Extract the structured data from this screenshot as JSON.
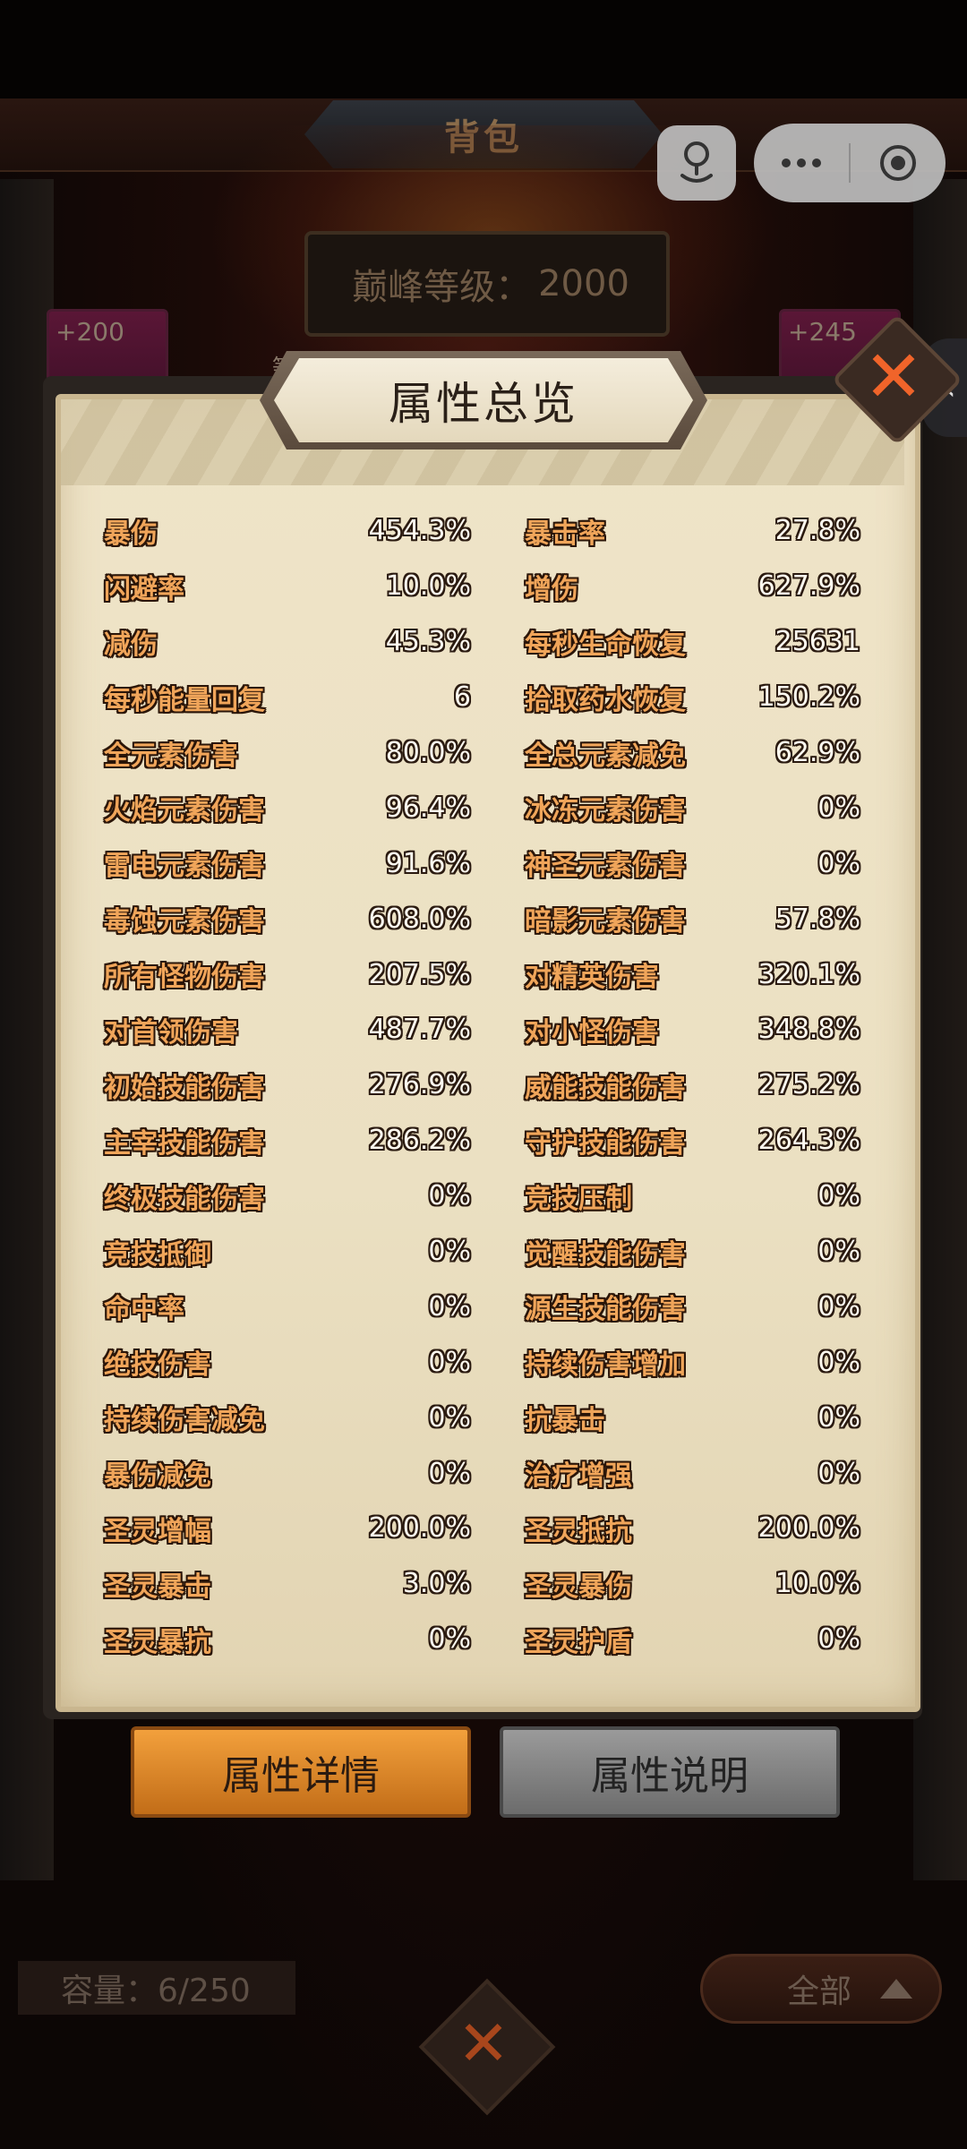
{
  "header": {
    "title": "背包"
  },
  "peak_level": {
    "label": "巅峰等级：",
    "value": "2000"
  },
  "bag_items": {
    "left_bonus": "+200",
    "right_bonus": "+245",
    "level_tag": "等级"
  },
  "dialog": {
    "title": "属性总览",
    "stats": [
      [
        {
          "name": "暴伤",
          "value": "454.3%"
        },
        {
          "name": "暴击率",
          "value": "27.8%"
        }
      ],
      [
        {
          "name": "闪避率",
          "value": "10.0%"
        },
        {
          "name": "增伤",
          "value": "627.9%"
        }
      ],
      [
        {
          "name": "减伤",
          "value": "45.3%"
        },
        {
          "name": "每秒生命恢复",
          "value": "25631"
        }
      ],
      [
        {
          "name": "每秒能量回复",
          "value": "6"
        },
        {
          "name": "拾取药水恢复",
          "value": "150.2%"
        }
      ],
      [
        {
          "name": "全元素伤害",
          "value": "80.0%"
        },
        {
          "name": "全总元素减免",
          "value": "62.9%"
        }
      ],
      [
        {
          "name": "火焰元素伤害",
          "value": "96.4%"
        },
        {
          "name": "冰冻元素伤害",
          "value": "0%"
        }
      ],
      [
        {
          "name": "雷电元素伤害",
          "value": "91.6%"
        },
        {
          "name": "神圣元素伤害",
          "value": "0%"
        }
      ],
      [
        {
          "name": "毒蚀元素伤害",
          "value": "608.0%"
        },
        {
          "name": "暗影元素伤害",
          "value": "57.8%"
        }
      ],
      [
        {
          "name": "所有怪物伤害",
          "value": "207.5%"
        },
        {
          "name": "对精英伤害",
          "value": "320.1%"
        }
      ],
      [
        {
          "name": "对首领伤害",
          "value": "487.7%"
        },
        {
          "name": "对小怪伤害",
          "value": "348.8%"
        }
      ],
      [
        {
          "name": "初始技能伤害",
          "value": "276.9%"
        },
        {
          "name": "威能技能伤害",
          "value": "275.2%"
        }
      ],
      [
        {
          "name": "主宰技能伤害",
          "value": "286.2%"
        },
        {
          "name": "守护技能伤害",
          "value": "264.3%"
        }
      ],
      [
        {
          "name": "终极技能伤害",
          "value": "0%"
        },
        {
          "name": "竞技压制",
          "value": "0%"
        }
      ],
      [
        {
          "name": "竞技抵御",
          "value": "0%"
        },
        {
          "name": "觉醒技能伤害",
          "value": "0%"
        }
      ],
      [
        {
          "name": "命中率",
          "value": "0%"
        },
        {
          "name": "源生技能伤害",
          "value": "0%"
        }
      ],
      [
        {
          "name": "绝技伤害",
          "value": "0%"
        },
        {
          "name": "持续伤害增加",
          "value": "0%"
        }
      ],
      [
        {
          "name": "持续伤害减免",
          "value": "0%"
        },
        {
          "name": "抗暴击",
          "value": "0%"
        }
      ],
      [
        {
          "name": "暴伤减免",
          "value": "0%"
        },
        {
          "name": "治疗增强",
          "value": "0%"
        }
      ],
      [
        {
          "name": "圣灵增幅",
          "value": "200.0%"
        },
        {
          "name": "圣灵抵抗",
          "value": "200.0%"
        }
      ],
      [
        {
          "name": "圣灵暴击",
          "value": "3.0%"
        },
        {
          "name": "圣灵暴伤",
          "value": "10.0%"
        }
      ],
      [
        {
          "name": "圣灵暴抗",
          "value": "0%"
        },
        {
          "name": "圣灵护盾",
          "value": "0%"
        }
      ]
    ]
  },
  "buttons": {
    "detail": "属性详情",
    "info": "属性说明"
  },
  "footer": {
    "capacity": "容量：6/250",
    "filter": "全部"
  },
  "colors": {
    "stat_name": "#f0a55a",
    "accent_orange": "#f0642a",
    "parchment": "#efe4c8"
  }
}
